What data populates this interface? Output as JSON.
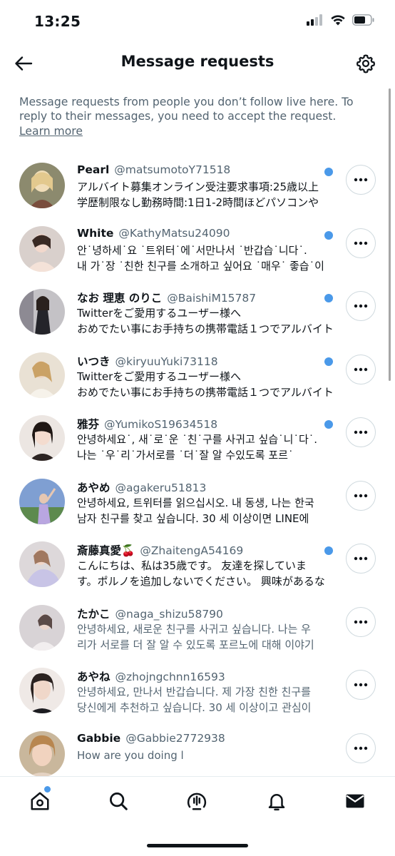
{
  "status_bar": {
    "time": "13:25"
  },
  "header": {
    "title": "Message requests"
  },
  "intro": {
    "text": "Message requests from people you don’t follow live here. To reply to their messages, you need to accept the request.",
    "link": "Learn more"
  },
  "requests": [
    {
      "name": "Pearl",
      "handle": "@matsumotoY71518",
      "line1": "アルバイト募集オンライン受注要求事項:25歳以上",
      "line2": "学歴制限なし勤務時間:1日1-2時間ほどパソコンや",
      "unread": true
    },
    {
      "name": "White",
      "handle": "@KathyMatsu24090",
      "line1": "안˙녕하세˙요 ˙트위터˙에˙서만나서 ˙반갑습˙니다˙.",
      "line2": "내 가˙장 ˙친한 친구를 소개하고 싶어요 ˙매우˙ 좋습˙이",
      "unread": true
    },
    {
      "name": "なお 理恵 のりこ",
      "handle": "@BaishiM15787",
      "line1": "Twitterをご愛用するユーザー様へ",
      "line2": "おめでたい事にお手持ちの携帯電話１つでアルバイト",
      "unread": true
    },
    {
      "name": "いつき",
      "handle": "@kiryuuYuki73118",
      "line1": "Twitterをご愛用するユーザー様へ",
      "line2": "おめでたい事にお手持ちの携帯電話１つでアルバイト",
      "unread": true
    },
    {
      "name": "雅芬",
      "handle": "@YumikoS19634518",
      "line1": "안녕하세요˙, 새˙로˙운 ˙친˙구를 사귀고 싶습˙니˙다˙.",
      "line2": "나는 ˙우˙리˙가서로를 ˙더˙잘 알 수있도록 포르˙",
      "unread": true
    },
    {
      "name": "あやめ",
      "handle": "@agakeru51813",
      "line1": "안녕하세요, 트위터를 읽으십시오. 내 동생, 나는 한국",
      "line2": "남자 친구를 찾고 싶습니다. 30 세 이상이면 LINE에",
      "unread": false
    },
    {
      "name": "斎藤真愛🍒",
      "handle": "@ZhaitengA54169",
      "line1": "こんにちは、私は35歳です。 友達を探していま",
      "line2": "す。ポルノを追加しないでください。 興味があるな",
      "unread": true
    },
    {
      "name": "たかこ",
      "handle": "@naga_shizu58790",
      "line1": "안녕하세요, 새로운 친구를 사귀고 싶습니다. 나는 우",
      "line2": "리가 서로를 더 잘 알 수 있도록 포르노에 대해 이야기",
      "unread": false,
      "read": true
    },
    {
      "name": "あやね",
      "handle": "@zhojngchnn16593",
      "line1": "안녕하세요, 만나서 반갑습니다. 제 가장 친한 친구를",
      "line2": "당신에게 추천하고 싶습니다. 30 세 이상이고 관심이",
      "unread": false,
      "read": true
    },
    {
      "name": "Gabbie",
      "handle": "@Gabbie2772938",
      "line1": "How are you doing l",
      "line2": "",
      "unread": false,
      "read": true
    }
  ],
  "icons": {
    "back": "arrow-left-icon",
    "settings": "gear-icon",
    "more": "ellipsis-icon",
    "tabs": [
      "home-icon",
      "search-icon",
      "spaces-icon",
      "bell-icon",
      "mail-icon"
    ]
  },
  "colors": {
    "accent": "#4a99e9",
    "secondary_text": "#536471"
  }
}
